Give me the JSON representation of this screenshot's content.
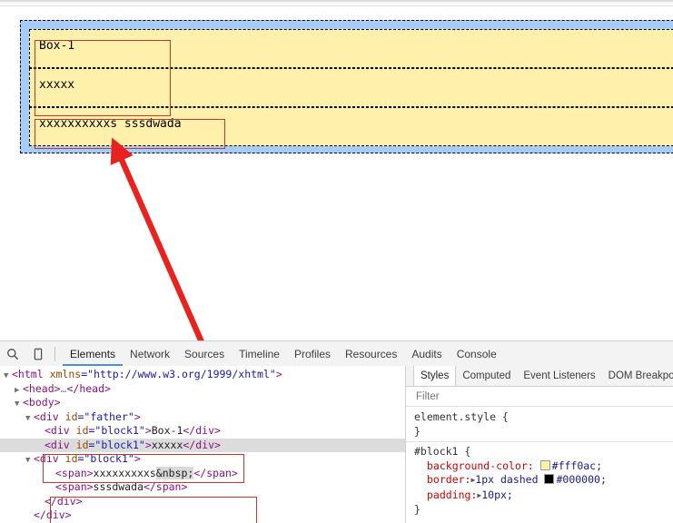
{
  "page": {
    "father_id": "father",
    "blocks": [
      {
        "name": "block-a",
        "text": "Box-1"
      },
      {
        "name": "block-b",
        "text": "xxxxx"
      },
      {
        "name": "block-c",
        "text_a": "xxxxxxxxxxs ",
        "text_b": "sssdwada"
      }
    ],
    "highlight_color": "#a8ccfa",
    "block_color": "#fff0ac",
    "annotation_color": "#c0392b"
  },
  "devtools": {
    "toolbar_icons": [
      {
        "name": "inspect-search-icon",
        "glyph": "search"
      },
      {
        "name": "device-toolbar-icon",
        "glyph": "device"
      }
    ],
    "tabs": [
      {
        "label": "Elements",
        "active": true
      },
      {
        "label": "Network",
        "active": false
      },
      {
        "label": "Sources",
        "active": false
      },
      {
        "label": "Timeline",
        "active": false
      },
      {
        "label": "Profiles",
        "active": false
      },
      {
        "label": "Resources",
        "active": false
      },
      {
        "label": "Audits",
        "active": false
      },
      {
        "label": "Console",
        "active": false
      }
    ],
    "dom": {
      "lines": [
        {
          "indent": 0,
          "twisty": "open",
          "html": "<span class=\"tagname\">&lt;html</span> <span class=\"attrname\">xmlns</span><span class=\"attrval\">=\"http://www.w3.org/1999/xhtml\"</span><span class=\"tagname\">&gt;</span>"
        },
        {
          "indent": 1,
          "twisty": "closed",
          "html": "<span class=\"tagname\">&lt;head&gt;</span><span class=\"ellip\">…</span><span class=\"tagname\">&lt;/head&gt;</span>"
        },
        {
          "indent": 1,
          "twisty": "open",
          "html": "<span class=\"tagname\">&lt;body&gt;</span>"
        },
        {
          "indent": 2,
          "twisty": "open",
          "html": "<span class=\"tagname\">&lt;div</span> <span class=\"attrname\">id</span><span class=\"attrval\">=\"father\"</span><span class=\"tagname\">&gt;</span>"
        },
        {
          "indent": 3,
          "twisty": "none",
          "html": "<span class=\"tagname\">&lt;div</span> <span class=\"attrname\">id</span><span class=\"attrval\">=\"block1\"</span><span class=\"tagname\">&gt;</span><span class=\"txt\">Box-1</span><span class=\"tagname\">&lt;/div&gt;</span>"
        },
        {
          "indent": 3,
          "twisty": "none",
          "selected": true,
          "html": "<span class=\"tagname\">&lt;div</span> <span class=\"attrname\">id</span><span class=\"attrval\">=\"block1\"</span><span class=\"tagname\">&gt;</span><span class=\"txt\">xxxxx</span><span class=\"tagname\">&lt;/div&gt;</span>"
        },
        {
          "indent": 2,
          "twisty": "open",
          "html": "<span class=\"tagname\">&lt;div</span> <span class=\"attrname\">id</span><span class=\"attrval\">=\"block1\"</span><span class=\"tagname\">&gt;</span>"
        },
        {
          "indent": 4,
          "twisty": "none",
          "html": "<span class=\"tagname\">&lt;span&gt;</span><span class=\"txt\">xxxxxxxxxs</span><span class=\"entity\">&amp;nbsp;</span><span class=\"tagname\">&lt;/span&gt;</span>"
        },
        {
          "indent": 4,
          "twisty": "none",
          "html": "<span class=\"tagname\">&lt;span&gt;</span><span class=\"txt\">sssdwada</span><span class=\"tagname\">&lt;/span&gt;</span>"
        },
        {
          "indent": 3,
          "twisty": "none",
          "html": "<span class=\"tagname\">&lt;/div&gt;</span>"
        },
        {
          "indent": 2,
          "twisty": "none",
          "html": "<span class=\"tagname\">&lt;/div&gt;</span>"
        }
      ]
    },
    "styles": {
      "tabs": [
        {
          "label": "Styles",
          "active": true
        },
        {
          "label": "Computed",
          "active": false
        },
        {
          "label": "Event Listeners",
          "active": false
        },
        {
          "label": "DOM Breakpoints",
          "active": false
        }
      ],
      "filter_placeholder": "Filter",
      "rules": [
        {
          "selector": "element.style {",
          "close": "}",
          "declarations": []
        },
        {
          "selector": "#block1 {",
          "close": "}",
          "declarations": [
            {
              "prop": "background-color:",
              "swatch": "#fff0ac",
              "expand": false,
              "value": "#fff0ac;"
            },
            {
              "prop": "border:",
              "expand": true,
              "value": "1px dashed",
              "swatch2": "#000000",
              "value2": "#000000;"
            },
            {
              "prop": "padding:",
              "expand": true,
              "value": "10px;"
            }
          ]
        }
      ]
    }
  }
}
